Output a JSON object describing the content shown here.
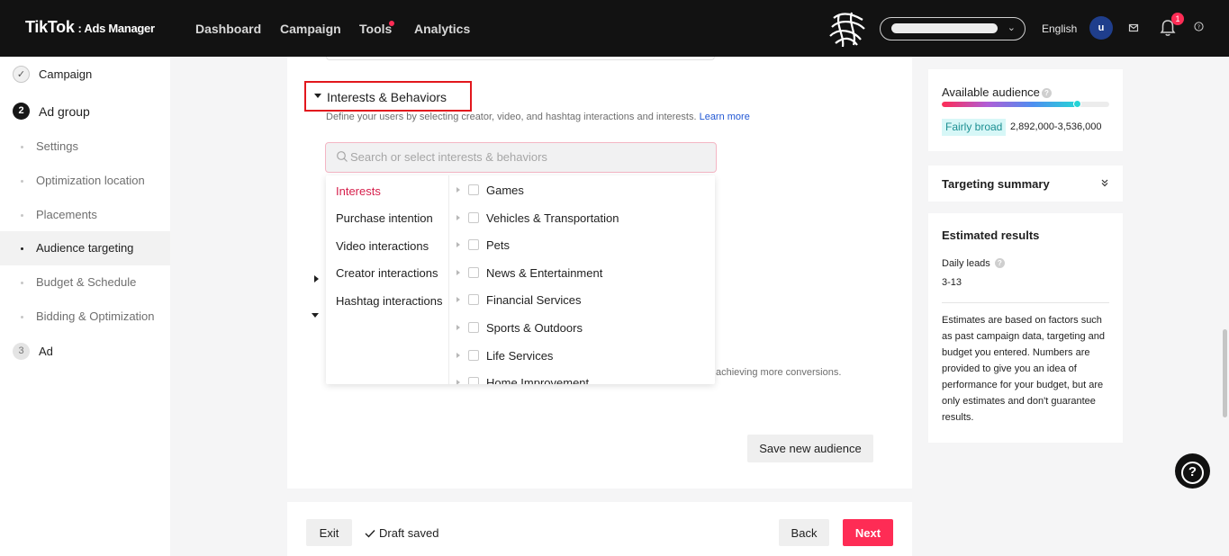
{
  "header": {
    "brand": "TikTok",
    "brand_sub": ": Ads Manager",
    "nav": [
      "Dashboard",
      "Campaign",
      "Tools",
      "Analytics"
    ],
    "language": "English",
    "avatar_initial": "u",
    "notification_count": "1",
    "accent_color": "#fe2c55"
  },
  "sidebar": {
    "campaign_label": "Campaign",
    "adgroup_step": "2",
    "adgroup_label": "Ad group",
    "items": [
      "Settings",
      "Optimization location",
      "Placements",
      "Audience targeting",
      "Budget & Schedule",
      "Bidding & Optimization"
    ],
    "ad_step": "3",
    "ad_label": "Ad"
  },
  "section": {
    "title": "Interests & Behaviors",
    "description": "Define your users by selecting creator, video, and hashtag interactions and interests.",
    "learn_more": "Learn more",
    "search_placeholder": "Search or select interests & behaviors",
    "behind_text": "achieving more conversions.",
    "save_audience": "Save new audience"
  },
  "dropdown": {
    "categories": [
      "Interests",
      "Purchase intention",
      "Video interactions",
      "Creator interactions",
      "Hashtag interactions"
    ],
    "options": [
      "Games",
      "Vehicles & Transportation",
      "Pets",
      "News & Entertainment",
      "Financial Services",
      "Sports & Outdoors",
      "Life Services",
      "Home Improvement"
    ]
  },
  "footer": {
    "exit": "Exit",
    "draft": "Draft saved",
    "back": "Back",
    "next": "Next"
  },
  "right": {
    "available_title": "Available audience",
    "breadth_label": "Fairly broad",
    "breadth_level": 0.81,
    "audience_range": "2,892,000-3,536,000",
    "targeting_summary": "Targeting summary",
    "estimated_title": "Estimated results",
    "daily_leads_label": "Daily leads",
    "daily_leads_value": "3-13",
    "note": "Estimates are based on factors such as past campaign data, targeting and budget you entered. Numbers are provided to give you an idea of performance for your budget, but are only estimates and don't guarantee results."
  }
}
